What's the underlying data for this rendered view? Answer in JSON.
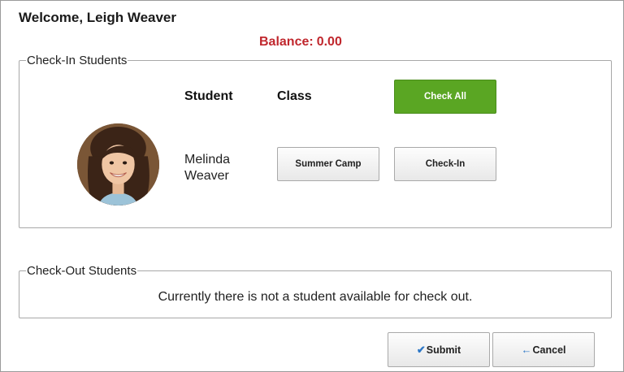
{
  "header": {
    "welcome": "Welcome, Leigh Weaver",
    "balance_label": "Balance:",
    "balance_value": "0.00",
    "balance_color": "#c0272d"
  },
  "checkin": {
    "legend": "Check-In Students",
    "col_student": "Student",
    "col_class": "Class",
    "check_all_label": "Check All",
    "check_all_color": "#5aa623",
    "students": [
      {
        "name_line1": "Melinda",
        "name_line2": "Weaver",
        "class_label": "Summer Camp",
        "checkin_label": "Check-In",
        "avatar": "student-photo"
      }
    ]
  },
  "checkout": {
    "legend": "Check-Out Students",
    "message": "Currently there is not a student available for check out."
  },
  "footer": {
    "submit_label": "Submit",
    "submit_icon": "checkmark-icon",
    "cancel_label": "Cancel",
    "cancel_icon": "arrow-left-icon"
  }
}
